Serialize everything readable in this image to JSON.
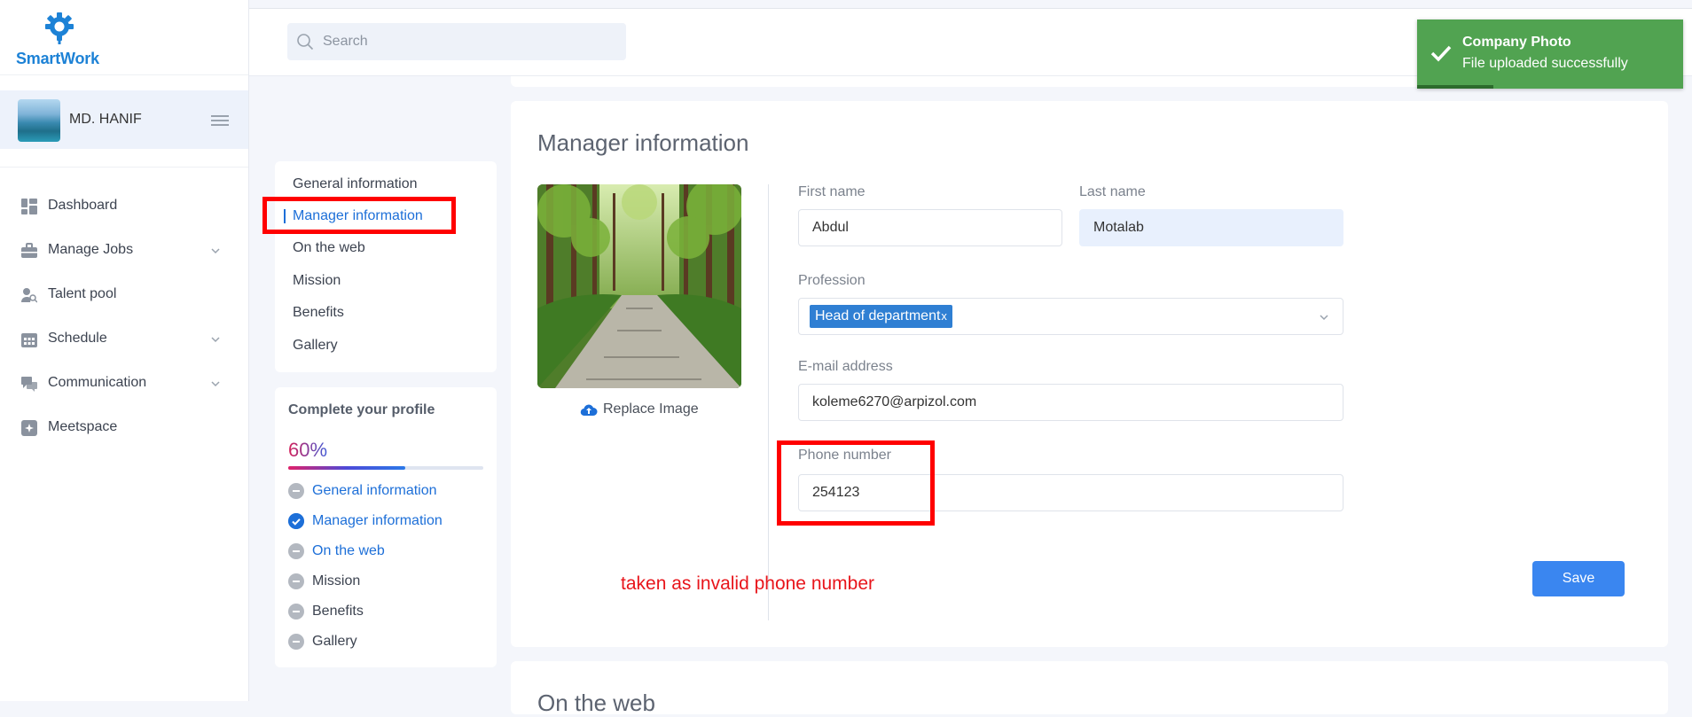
{
  "app": {
    "name": "SmartWork"
  },
  "user": {
    "name": "MD. HANIF"
  },
  "sidebar": {
    "items": [
      {
        "label": "Dashboard",
        "icon": "dashboard-icon",
        "has_chevron": false
      },
      {
        "label": "Manage Jobs",
        "icon": "briefcase-icon",
        "has_chevron": true
      },
      {
        "label": "Talent pool",
        "icon": "people-search-icon",
        "has_chevron": false
      },
      {
        "label": "Schedule",
        "icon": "calendar-icon",
        "has_chevron": true
      },
      {
        "label": "Communication",
        "icon": "chat-icon",
        "has_chevron": true
      },
      {
        "label": "Meetspace",
        "icon": "meetspace-icon",
        "has_chevron": false
      }
    ]
  },
  "search": {
    "placeholder": "Search"
  },
  "subnav": {
    "items": [
      "General information",
      "Manager information",
      "On the web",
      "Mission",
      "Benefits",
      "Gallery"
    ],
    "active": "Manager information"
  },
  "profile": {
    "title": "Complete your profile",
    "percent_label": "60%",
    "percent": 60,
    "steps": [
      {
        "label": "General information",
        "done": false,
        "highlight": true
      },
      {
        "label": "Manager information",
        "done": true,
        "highlight": true
      },
      {
        "label": "On the web",
        "done": false,
        "highlight": true
      },
      {
        "label": "Mission",
        "done": false,
        "highlight": false
      },
      {
        "label": "Benefits",
        "done": false,
        "highlight": false
      },
      {
        "label": "Gallery",
        "done": false,
        "highlight": false
      }
    ]
  },
  "form": {
    "title": "Manager information",
    "replace_image_label": "Replace Image",
    "first_name_label": "First name",
    "first_name_value": "Abdul",
    "last_name_label": "Last name",
    "last_name_value": "Motalab",
    "profession_label": "Profession",
    "profession_value": "Head of department",
    "profession_clear": "x",
    "email_label": "E-mail address",
    "email_value": "koleme6270@arpizol.com",
    "phone_label": "Phone number",
    "phone_value": "254123",
    "save_label": "Save"
  },
  "annotation": {
    "text": "taken as invalid phone number",
    "color": "#e8151b"
  },
  "next_section": {
    "title": "On the web"
  },
  "toast": {
    "title": "Company Photo",
    "message": "File uploaded successfully",
    "color": "#51a351"
  },
  "colors": {
    "accent": "#1d6fd8",
    "save_button": "#3a86f0",
    "highlight_box": "#ff0000"
  }
}
